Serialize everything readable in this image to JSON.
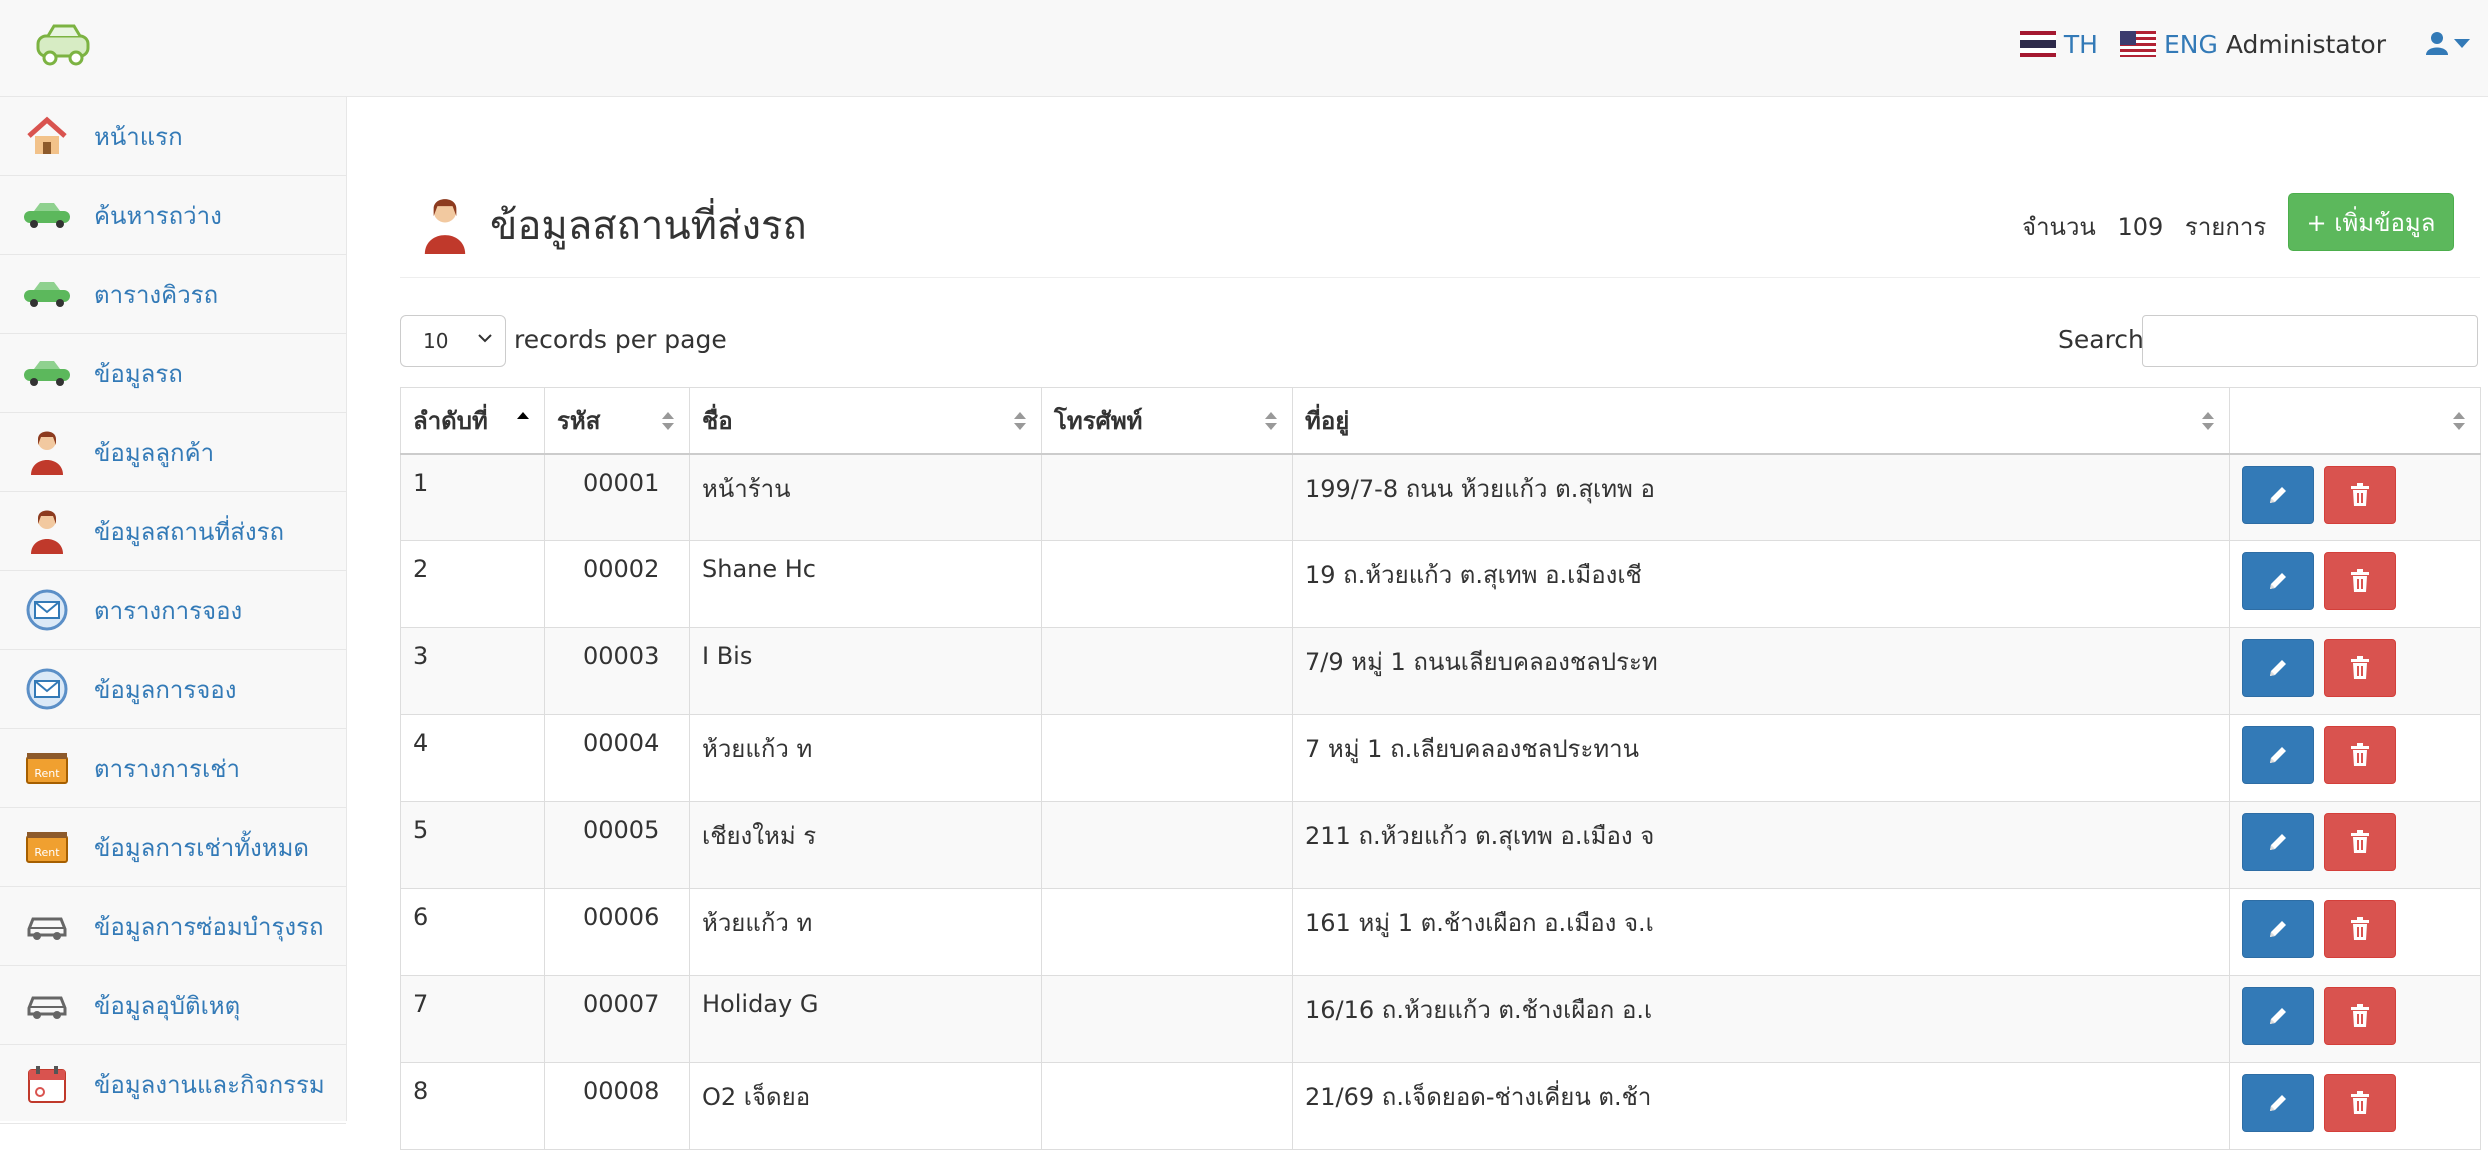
{
  "header": {
    "lang_th": "TH",
    "lang_en": "ENG",
    "admin_name": "Administator"
  },
  "sidebar": {
    "items": [
      {
        "label": "หน้าแรก",
        "icon": "home-icon"
      },
      {
        "label": "ค้นหารถว่าง",
        "icon": "car-icon"
      },
      {
        "label": "ตารางคิวรถ",
        "icon": "car-icon"
      },
      {
        "label": "ข้อมูลรถ",
        "icon": "car-icon"
      },
      {
        "label": "ข้อมูลลูกค้า",
        "icon": "person-icon"
      },
      {
        "label": "ข้อมูลสถานที่ส่งรถ",
        "icon": "person-icon"
      },
      {
        "label": "ตารางการจอง",
        "icon": "booking-icon"
      },
      {
        "label": "ข้อมูลการจอง",
        "icon": "booking-icon"
      },
      {
        "label": "ตารางการเช่า",
        "icon": "rent-icon"
      },
      {
        "label": "ข้อมูลการเช่าทั้งหมด",
        "icon": "rent-icon"
      },
      {
        "label": "ข้อมูลการซ่อมบำรุงรถ",
        "icon": "car-outline-icon"
      },
      {
        "label": "ข้อมูลอุบัติเหตุ",
        "icon": "car-outline-icon"
      },
      {
        "label": "ข้อมูลงานและกิจกรรม",
        "icon": "calendar-icon"
      }
    ]
  },
  "page": {
    "title": "ข้อมูลสถานที่ส่งรถ",
    "count_prefix": "จำนวน",
    "count_value": "109",
    "count_suffix": "รายการ",
    "add_button": "+ เพิ่มข้อมูล"
  },
  "controls": {
    "rpp_value": "10",
    "rpp_label": "records per page",
    "search_label": "Search:"
  },
  "table": {
    "columns": [
      "ลำดับที่",
      "รหัส",
      "ชื่อ",
      "โทรศัพท์",
      "ที่อยู่",
      ""
    ],
    "rows": [
      {
        "no": "1",
        "code": "00001",
        "name": "หน้าร้าน",
        "phone": "",
        "address": "199/7-8 ถนน ห้วยแก้ว ต.สุเทพ อ"
      },
      {
        "no": "2",
        "code": "00002",
        "name": "Shane Hc",
        "phone": "",
        "address": "19 ถ.ห้วยแก้ว ต.สุเทพ อ.เมืองเชี"
      },
      {
        "no": "3",
        "code": "00003",
        "name": "I Bis",
        "phone": "",
        "address": "7/9 หมู่ 1 ถนนเลียบคลองชลประท"
      },
      {
        "no": "4",
        "code": "00004",
        "name": "ห้วยแก้ว ท",
        "phone": "",
        "address": "7 หมู่ 1 ถ.เลียบคลองชลประทาน"
      },
      {
        "no": "5",
        "code": "00005",
        "name": "เชียงใหม่ ร",
        "phone": "",
        "address": "211 ถ.ห้วยแก้ว ต.สุเทพ อ.เมือง จ"
      },
      {
        "no": "6",
        "code": "00006",
        "name": "ห้วยแก้ว ท",
        "phone": "",
        "address": "161 หมู่ 1 ต.ช้างเผือก อ.เมือง จ.เ"
      },
      {
        "no": "7",
        "code": "00007",
        "name": "Holiday G",
        "phone": "",
        "address": "16/16 ถ.ห้วยแก้ว ต.ช้างเผือก อ.เ"
      },
      {
        "no": "8",
        "code": "00008",
        "name": "O2 เจ็ดยอ",
        "phone": "",
        "address": "21/69 ถ.เจ็ดยอด-ช่างเคี่ยน ต.ช้า"
      }
    ]
  },
  "colors": {
    "link": "#337ab7",
    "success": "#5cb85c",
    "danger": "#d9534f",
    "primary": "#337ab7"
  }
}
